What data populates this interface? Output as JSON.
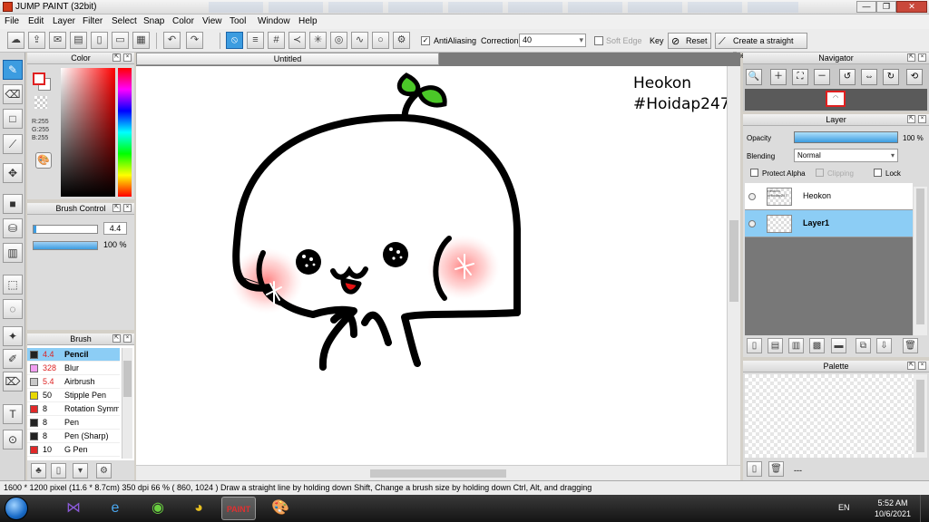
{
  "window": {
    "title": "JUMP PAINT (32bit)",
    "minimize": "—",
    "maximize": "❐",
    "close": "✕"
  },
  "menu": [
    "File",
    "Edit",
    "Layer",
    "Filter",
    "Select",
    "Snap",
    "Color",
    "View",
    "Tool",
    "Window",
    "Help"
  ],
  "toolbar": {
    "antialiasing_label": "AntiAliasing",
    "antialiasing_checked": "✓",
    "correction_label": "Correction",
    "correction_value": "40",
    "soft_edge_label": "Soft Edge",
    "key_label": "Key",
    "reset_label": "Reset",
    "straight_line_label": "Create a straight line"
  },
  "color_panel": {
    "title": "Color",
    "rgb_readout": "R:255\nG:255\nB:255",
    "foreground": "#ffffff",
    "accent": "#e02020"
  },
  "brush_control": {
    "title": "Brush Control",
    "size_value": "4.4",
    "opacity_value": "100 %"
  },
  "brush_panel": {
    "title": "Brush",
    "items": [
      {
        "color": "#222222",
        "size": "4.4",
        "name": "Pencil",
        "selected": true,
        "red_size": true
      },
      {
        "color": "#f29ef0",
        "size": "328",
        "name": "Blur",
        "selected": false,
        "red_size": true
      },
      {
        "color": "#c8c8c8",
        "size": "5.4",
        "name": "Airbrush",
        "selected": false,
        "red_size": true
      },
      {
        "color": "#e8d800",
        "size": "50",
        "name": "Stipple Pen",
        "selected": false,
        "red_size": false
      },
      {
        "color": "#e02828",
        "size": "8",
        "name": "Rotation Symm",
        "selected": false,
        "red_size": false
      },
      {
        "color": "#222222",
        "size": "8",
        "name": "Pen",
        "selected": false,
        "red_size": false
      },
      {
        "color": "#222222",
        "size": "8",
        "name": "Pen (Sharp)",
        "selected": false,
        "red_size": false
      },
      {
        "color": "#e02828",
        "size": "10",
        "name": "G Pen",
        "selected": false,
        "red_size": false
      }
    ]
  },
  "canvas": {
    "tab_title": "Untitled",
    "signature_line1": "Heokon",
    "signature_line2": "#Hoidap247"
  },
  "navigator": {
    "title": "Navigator"
  },
  "layer_panel": {
    "title": "Layer",
    "opacity_label": "Opacity",
    "opacity_value": "100 %",
    "opacity_fraction": 1.0,
    "blending_label": "Blending",
    "blending_value": "Normal",
    "protect_alpha_label": "Protect Alpha",
    "clipping_label": "Clipping",
    "lock_label": "Lock",
    "layers": [
      {
        "name": "Heokon",
        "selected": false,
        "thumb_text": "Heokon #Hoidap247"
      },
      {
        "name": "Layer1",
        "selected": true,
        "thumb_text": ""
      }
    ]
  },
  "palette_panel": {
    "title": "Palette",
    "dash": "---"
  },
  "statusbar": {
    "text": "1600 * 1200 pixel   (11.6 * 8.7cm)   350 dpi   66 %   ( 860, 1024 )   Draw a straight line by holding down Shift, Change a brush size by holding down Ctrl, Alt, and dragging"
  },
  "taskbar": {
    "language": "EN",
    "time": "5:52 AM",
    "date": "10/6/2021"
  }
}
